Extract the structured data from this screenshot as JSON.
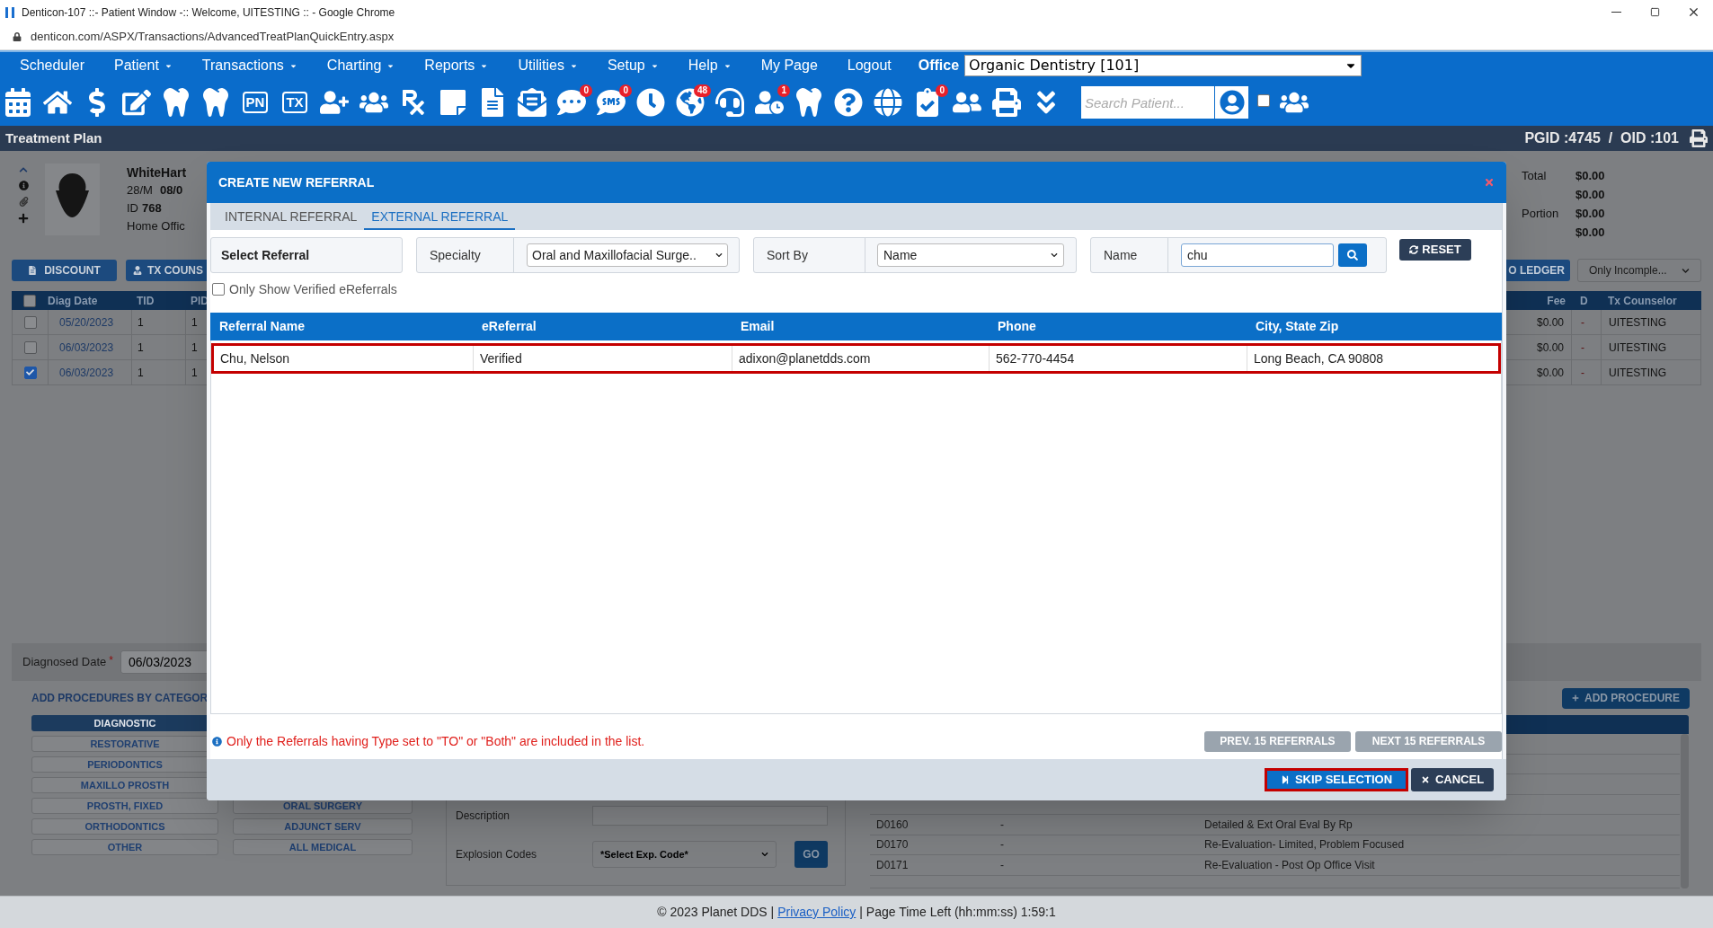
{
  "browser": {
    "title": "Denticon-107 ::- Patient Window -:: Welcome, UITESTING :: - Google Chrome",
    "url": "denticon.com/ASPX/Transactions/AdvancedTreatPlanQuickEntry.aspx"
  },
  "menu": [
    {
      "label": "Scheduler",
      "dropdown": false
    },
    {
      "label": "Patient",
      "dropdown": true
    },
    {
      "label": "Transactions",
      "dropdown": true
    },
    {
      "label": "Charting",
      "dropdown": true
    },
    {
      "label": "Reports",
      "dropdown": true
    },
    {
      "label": "Utilities",
      "dropdown": true
    },
    {
      "label": "Setup",
      "dropdown": true
    },
    {
      "label": "Help",
      "dropdown": true
    },
    {
      "label": "My Page",
      "dropdown": false
    },
    {
      "label": "Logout",
      "dropdown": false
    }
  ],
  "office": {
    "label": "Office",
    "value": "Organic Dentistry [101]"
  },
  "toolbar": {
    "icons": [
      {
        "kind": "calendar"
      },
      {
        "kind": "home"
      },
      {
        "kind": "dollar"
      },
      {
        "kind": "edit"
      },
      {
        "kind": "tooth"
      },
      {
        "kind": "implant"
      },
      {
        "kind": "text",
        "label": "PN"
      },
      {
        "kind": "text",
        "label": "TX"
      },
      {
        "kind": "user-add"
      },
      {
        "kind": "users-add"
      },
      {
        "kind": "rx"
      },
      {
        "kind": "note"
      },
      {
        "kind": "scanner"
      },
      {
        "kind": "mail"
      },
      {
        "kind": "chat",
        "badge": "0"
      },
      {
        "kind": "sms",
        "badge": "0"
      },
      {
        "kind": "clock"
      },
      {
        "kind": "globe-users",
        "badge": "48"
      },
      {
        "kind": "headset"
      },
      {
        "kind": "user-refresh",
        "badge": "1"
      },
      {
        "kind": "tooth"
      },
      {
        "kind": "tooth-question"
      },
      {
        "kind": "globe"
      },
      {
        "kind": "checklist",
        "badge": "0"
      },
      {
        "kind": "family"
      },
      {
        "kind": "printer"
      },
      {
        "kind": "chevrons-down"
      }
    ],
    "search_placeholder": "Search Patient...",
    "checked": false
  },
  "page_bar": {
    "title": "Treatment Plan",
    "ids": "PGID :4745  /  OID :101"
  },
  "patient": {
    "name": "WhiteHart",
    "age_sex": "28/M",
    "dob": "08/0",
    "id_label": "ID",
    "id": "768",
    "office": "Home Offic"
  },
  "totals": [
    {
      "label": "Total",
      "value": "$0.00"
    },
    {
      "value": "$0.00"
    },
    {
      "label": "Portion",
      "value": "$0.00"
    },
    {
      "value": "$0.00"
    }
  ],
  "actions": [
    "DISCOUNT",
    "TX COUNS"
  ],
  "ledger_button": "O LEDGER",
  "status_filter": "Only Incomple...",
  "plans": {
    "all_checked": false,
    "columns_left": [
      "Diag Date",
      "TID",
      "PID"
    ],
    "columns_right": [
      "Fee",
      "D",
      "Tx Counselor"
    ],
    "rows": [
      {
        "checked": false,
        "diag_date": "05/20/2023",
        "tid": "1",
        "pid": "1",
        "fee": "$0.00",
        "d": "-",
        "counselor": "UITESTING"
      },
      {
        "checked": false,
        "diag_date": "06/03/2023",
        "tid": "1",
        "pid": "1",
        "fee": "$0.00",
        "d": "-",
        "counselor": "UITESTING"
      },
      {
        "checked": true,
        "diag_date": "06/03/2023",
        "tid": "1",
        "pid": "1",
        "fee": "$0.00",
        "d": "-",
        "counselor": "UITESTING"
      }
    ]
  },
  "diagnosed": {
    "label": "Diagnosed Date",
    "required_mark": "*",
    "value": "06/03/2023"
  },
  "categories": {
    "title": "ADD PROCEDURES BY CATEGOR",
    "column_1": [
      {
        "label": "DIAGNOSTIC",
        "selected": true
      },
      {
        "label": "RESTORATIVE",
        "selected": false
      },
      {
        "label": "PERIODONTICS",
        "selected": false
      },
      {
        "label": "MAXILLO PROSTH",
        "selected": false
      },
      {
        "label": "PROSTH, FIXED",
        "selected": false
      },
      {
        "label": "ORTHODONTICS",
        "selected": false
      },
      {
        "label": "OTHER",
        "selected": false
      }
    ],
    "column_2": [
      {
        "label": "ORAL SURGERY",
        "selected": false
      },
      {
        "label": "ADJUNCT SERV",
        "selected": false
      },
      {
        "label": "ALL MEDICAL",
        "selected": false
      }
    ]
  },
  "description_label": "Description",
  "explosion": {
    "label": "Explosion Codes",
    "value": "*Select Exp. Code*",
    "button": "GO"
  },
  "add_procedure": "ADD PROCEDURE",
  "procedures": [
    {
      "code": "D0160",
      "fee": "-",
      "description": "Detailed & Ext Oral Eval By Rp"
    },
    {
      "code": "D0170",
      "fee": "-",
      "description": "Re-Evaluation- Limited, Problem Focused"
    },
    {
      "code": "D0171",
      "fee": "-",
      "description": "Re-Evaluation - Post Op Office Visit"
    }
  ],
  "modal": {
    "title": "CREATE NEW REFERRAL",
    "tabs": [
      {
        "label": "INTERNAL REFERRAL",
        "selected": false
      },
      {
        "label": "EXTERNAL REFERRAL",
        "selected": true
      }
    ],
    "select_referral": "Select Referral",
    "specialty": {
      "label": "Specialty",
      "value": "Oral and Maxillofacial Surge.."
    },
    "sort_by": {
      "label": "Sort By",
      "value": "Name"
    },
    "name": {
      "label": "Name",
      "value": "chu"
    },
    "reset": "RESET",
    "verified_only": {
      "label": "Only Show Verified eReferrals",
      "checked": false
    },
    "columns": [
      "Referral Name",
      "eReferral",
      "Email",
      "Phone",
      "City, State Zip"
    ],
    "rows": [
      {
        "selected": true,
        "cells": [
          "Chu, Nelson",
          "Verified",
          "adixon@planetdds.com",
          "562-770-4454",
          "Long Beach, CA 90808"
        ]
      }
    ],
    "info": "Only the Referrals having Type set to \"TO\" or \"Both\" are included in the list.",
    "prev": {
      "label": "PREV. 15 REFERRALS",
      "disabled": true
    },
    "next": {
      "label": "NEXT 15 REFERRALS",
      "disabled": true
    },
    "skip": "SKIP SELECTION",
    "cancel": "CANCEL"
  },
  "footer": {
    "copyright": "© 2023 Planet DDS |",
    "link": "Privacy Policy",
    "time": "| Page Time Left (hh:mm:ss) 1:59:1"
  }
}
